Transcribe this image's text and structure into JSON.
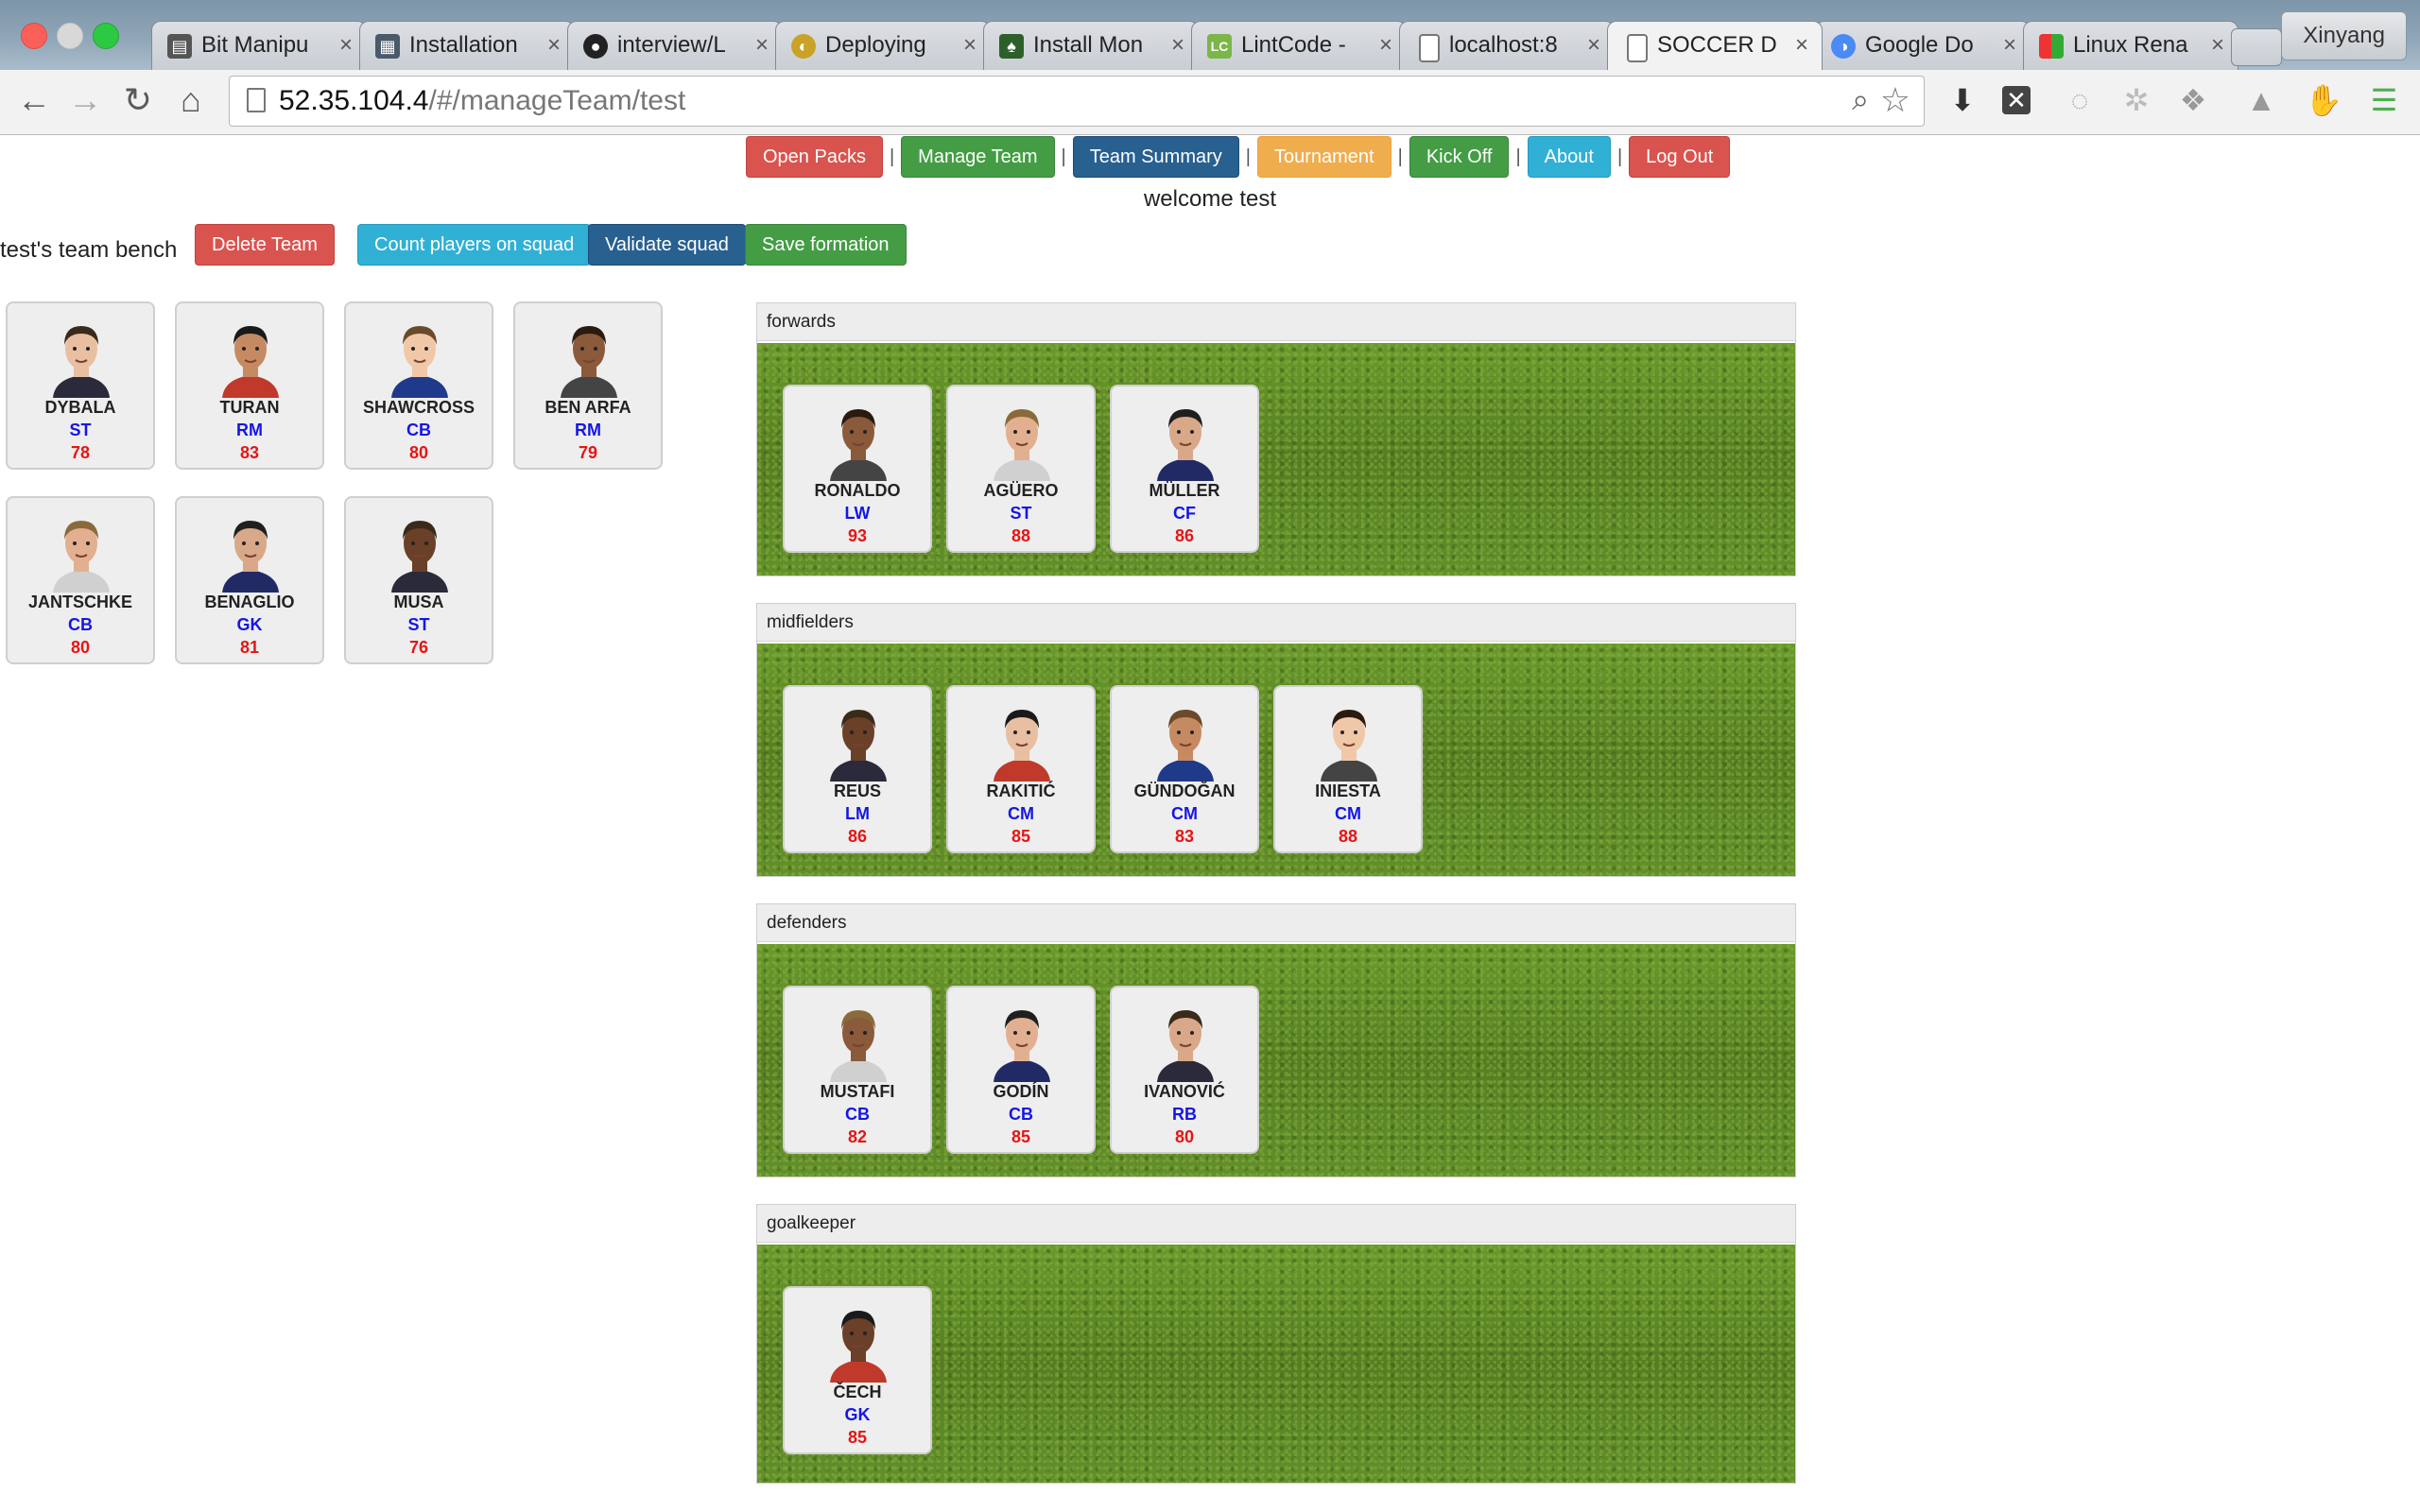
{
  "browser": {
    "tabs": [
      {
        "title": "Bit Manipu",
        "fav": "book-icon"
      },
      {
        "title": "Installation",
        "fav": "doc-grid-icon"
      },
      {
        "title": "interview/L",
        "fav": "github-icon"
      },
      {
        "title": "Deploying",
        "fav": "deploy-icon"
      },
      {
        "title": "Install Mon",
        "fav": "mongodb-leaf-icon"
      },
      {
        "title": "LintCode -",
        "fav": "lintcode-icon"
      },
      {
        "title": "localhost:8",
        "fav": "page-icon"
      },
      {
        "title": "SOCCER D",
        "fav": "page-icon"
      },
      {
        "title": "Google Do",
        "fav": "google-docs-icon"
      },
      {
        "title": "Linux Rena",
        "fav": "grid-color-icon"
      }
    ],
    "profile": "Xinyang",
    "url_host": "52.35.104.4",
    "url_path": "/#/manageTeam/test"
  },
  "nav": {
    "open_packs": "Open Packs",
    "manage_team": "Manage Team",
    "team_summary": "Team Summary",
    "tournament": "Tournament",
    "kick_off": "Kick Off",
    "about": "About",
    "log_out": "Log Out"
  },
  "welcome": "welcome test",
  "bench": {
    "title": "test's team bench",
    "delete_team": "Delete Team",
    "count_players": "Count players on squad",
    "validate_squad": "Validate squad",
    "save_formation": "Save formation",
    "players": [
      {
        "name": "DYBALA",
        "pos": "ST",
        "rating": "78"
      },
      {
        "name": "TURAN",
        "pos": "RM",
        "rating": "83"
      },
      {
        "name": "SHAWCROSS",
        "pos": "CB",
        "rating": "80"
      },
      {
        "name": "BEN ARFA",
        "pos": "RM",
        "rating": "79"
      },
      {
        "name": "JANTSCHKE",
        "pos": "CB",
        "rating": "80"
      },
      {
        "name": "BENAGLIO",
        "pos": "GK",
        "rating": "81"
      },
      {
        "name": "MUSA",
        "pos": "ST",
        "rating": "76"
      }
    ]
  },
  "formation": {
    "forwards": {
      "label": "forwards",
      "players": [
        {
          "name": "RONALDO",
          "pos": "LW",
          "rating": "93"
        },
        {
          "name": "AGÜERO",
          "pos": "ST",
          "rating": "88"
        },
        {
          "name": "MÜLLER",
          "pos": "CF",
          "rating": "86"
        }
      ]
    },
    "midfielders": {
      "label": "midfielders",
      "players": [
        {
          "name": "REUS",
          "pos": "LM",
          "rating": "86"
        },
        {
          "name": "RAKITIĆ",
          "pos": "CM",
          "rating": "85"
        },
        {
          "name": "GÜNDOĞAN",
          "pos": "CM",
          "rating": "83"
        },
        {
          "name": "INIESTA",
          "pos": "CM",
          "rating": "88"
        }
      ]
    },
    "defenders": {
      "label": "defenders",
      "players": [
        {
          "name": "MUSTAFI",
          "pos": "CB",
          "rating": "82"
        },
        {
          "name": "GODÍN",
          "pos": "CB",
          "rating": "85"
        },
        {
          "name": "IVANOVIĆ",
          "pos": "RB",
          "rating": "80"
        }
      ]
    },
    "goalkeeper": {
      "label": "goalkeeper",
      "players": [
        {
          "name": "ČECH",
          "pos": "GK",
          "rating": "85"
        }
      ]
    }
  },
  "colors": {
    "position": "#1515e6",
    "rating": "#e61515",
    "pitch": "#5e8a26"
  }
}
